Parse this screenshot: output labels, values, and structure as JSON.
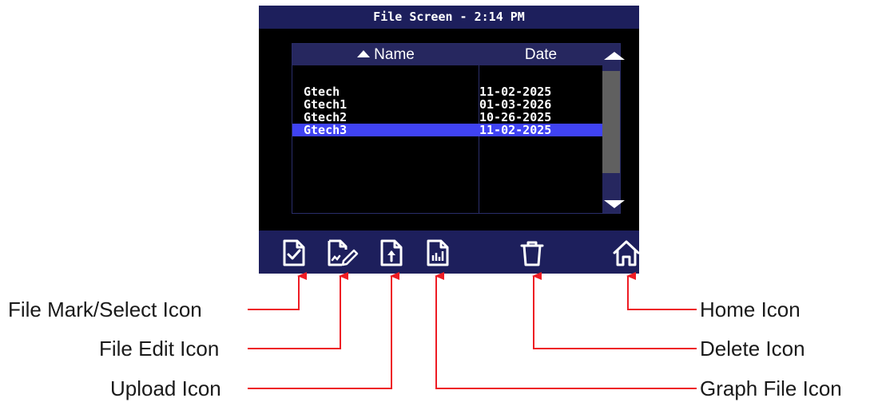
{
  "title_bar": {
    "text": "File Screen - 2:14 PM"
  },
  "table": {
    "headers": {
      "name": "Name",
      "date": "Date"
    },
    "sort_indicator_icon": "triangle-up-icon",
    "rows": [
      {
        "name": "Gtech",
        "date": "11-02-2025",
        "selected": false
      },
      {
        "name": "Gtech1",
        "date": "01-03-2026",
        "selected": false
      },
      {
        "name": "Gtech2",
        "date": "10-26-2025",
        "selected": false
      },
      {
        "name": "Gtech3",
        "date": "11-02-2025",
        "selected": true
      }
    ]
  },
  "toolbar": {
    "icons": [
      "file-mark-select-icon",
      "file-edit-icon",
      "upload-icon",
      "graph-file-icon",
      "delete-icon",
      "home-icon"
    ]
  },
  "callouts": {
    "file_mark_select": "File Mark/Select Icon",
    "file_edit": "File Edit Icon",
    "upload": "Upload Icon",
    "home": "Home Icon",
    "delete": "Delete Icon",
    "graph_file": "Graph File Icon"
  },
  "colors": {
    "title_bg": "#1d1f5c",
    "header_bg": "#26275f",
    "screen_bg": "#000000",
    "selected_row": "#4043f4",
    "scroll_track": "#606060",
    "arrow": "#ee1c24"
  }
}
